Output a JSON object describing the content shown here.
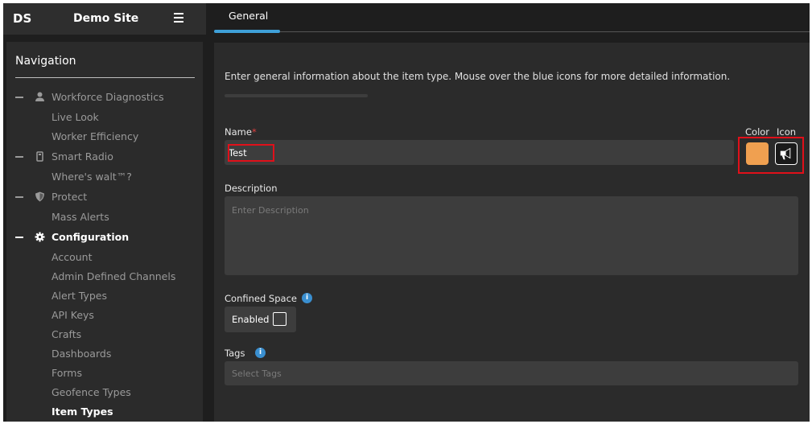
{
  "header": {
    "logo": "DS",
    "site_name": "Demo Site"
  },
  "sidebar": {
    "title": "Navigation",
    "items": [
      {
        "label": "Workforce Diagnostics",
        "icon": "person-icon",
        "group": true
      },
      {
        "label": "Live Look"
      },
      {
        "label": "Worker Efficiency"
      },
      {
        "label": "Smart Radio",
        "icon": "radio-icon",
        "group": true
      },
      {
        "label": "Where's walt™?"
      },
      {
        "label": "Protect",
        "icon": "shield-icon",
        "group": true
      },
      {
        "label": "Mass Alerts"
      },
      {
        "label": "Configuration",
        "icon": "gear-icon",
        "group": true,
        "active": true
      },
      {
        "label": "Account"
      },
      {
        "label": "Admin Defined Channels"
      },
      {
        "label": "Alert Types"
      },
      {
        "label": "API Keys"
      },
      {
        "label": "Crafts"
      },
      {
        "label": "Dashboards"
      },
      {
        "label": "Forms"
      },
      {
        "label": "Geofence Types"
      },
      {
        "label": "Item Types",
        "active": true
      }
    ]
  },
  "tabs": [
    {
      "label": "General",
      "active": true
    }
  ],
  "form": {
    "intro": "Enter general information about the item type. Mouse over the blue icons for more detailed information.",
    "name_label": "Name",
    "name_required_mark": "*",
    "name_value": "Test",
    "color_label": "Color",
    "icon_label": "Icon",
    "color_value": "#f0a050",
    "icon_name": "megaphone-icon",
    "description_label": "Description",
    "description_placeholder": "Enter Description",
    "confined_space_label": "Confined Space",
    "enabled_label": "Enabled",
    "enabled_checked": false,
    "tags_label": "Tags",
    "tags_placeholder": "Select Tags"
  },
  "colors": {
    "accent": "#3fa0d8",
    "info": "#3a8fd0",
    "highlight": "#e0101a"
  }
}
